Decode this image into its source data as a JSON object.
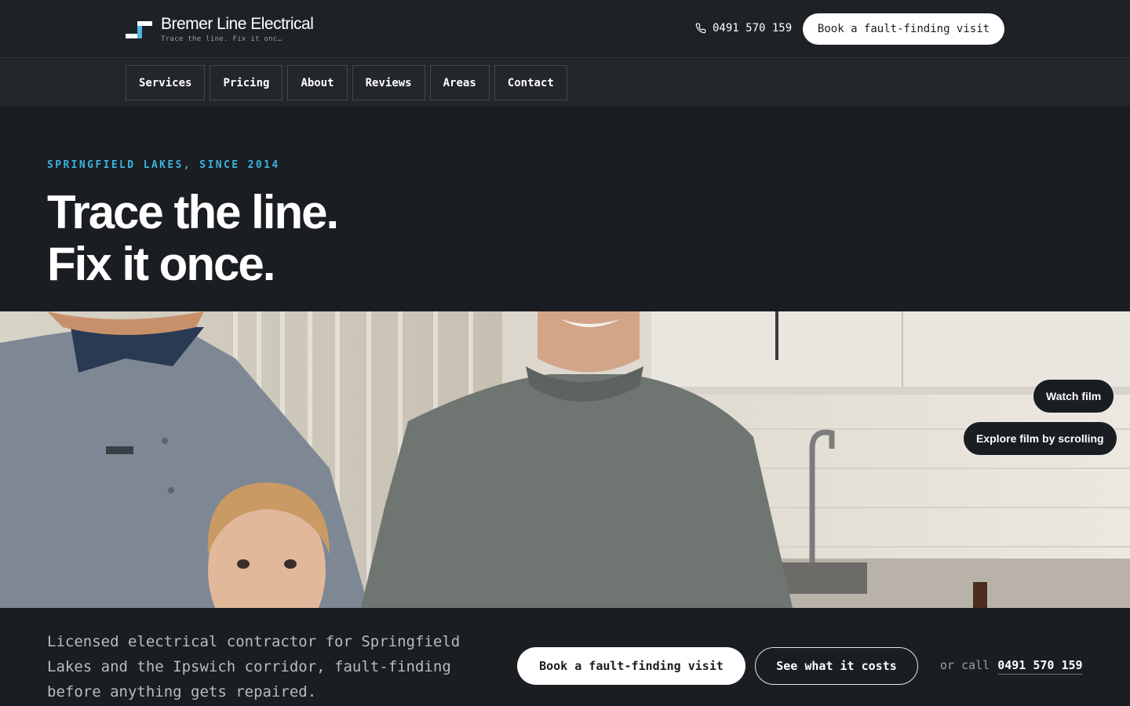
{
  "header": {
    "brand_name": "Bremer Line Electrical",
    "brand_tagline": "Trace the line. Fix it onc…",
    "phone": "0491 570 159",
    "cta_label": "Book a fault-finding visit",
    "accent_color": "#3ab4e0"
  },
  "nav": {
    "items": [
      {
        "label": "Services"
      },
      {
        "label": "Pricing"
      },
      {
        "label": "About"
      },
      {
        "label": "Reviews"
      },
      {
        "label": "Areas"
      },
      {
        "label": "Contact"
      }
    ]
  },
  "hero": {
    "eyebrow": "SPRINGFIELD LAKES, SINCE 2014",
    "headline_line1": "Trace the line.",
    "headline_line2": "Fix it once."
  },
  "video": {
    "watch_label": "Watch film",
    "explore_label": "Explore film by scrolling"
  },
  "intro": {
    "lede": "Licensed electrical contractor for Springfield Lakes and the Ipswich corridor, fault-finding before anything gets repaired.",
    "primary_cta": "Book a fault-finding visit",
    "secondary_cta": "See what it costs",
    "or_call_prefix": "or call",
    "phone": "0491 570 159"
  },
  "icons": {
    "phone": "phone-icon",
    "logo": "logo-mark-icon"
  }
}
